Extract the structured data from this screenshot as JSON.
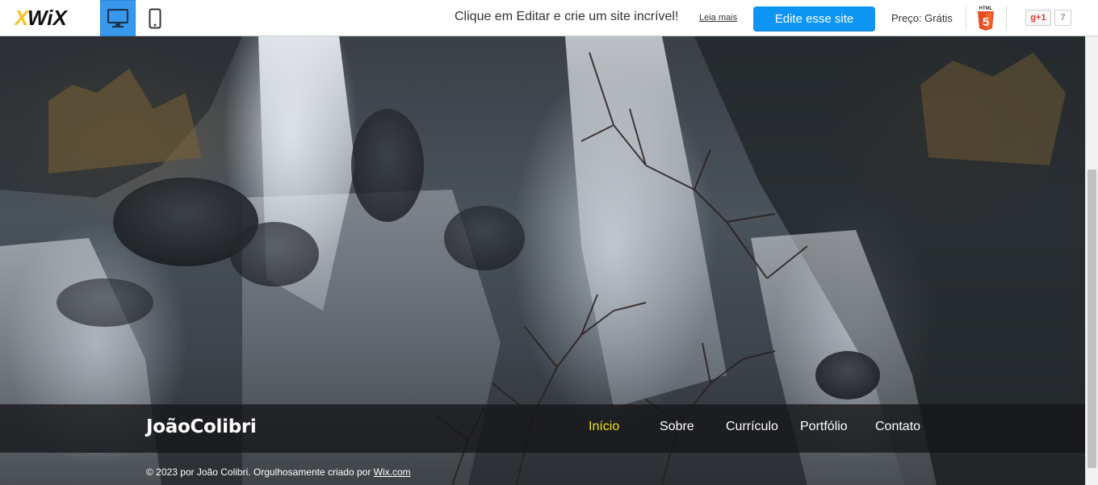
{
  "topbar": {
    "logo_text": "WIX",
    "logo_x": "X",
    "logo_rest": "WIX",
    "devices": [
      {
        "label": "desktop",
        "icon": "desktop-monitor-icon",
        "active": true
      },
      {
        "label": "mobile",
        "icon": "mobile-phone-icon",
        "active": false
      }
    ],
    "promo_text": "Clique em Editar e crie um site incrível!",
    "read_more": "Leia mais",
    "edit_button": "Edite esse site",
    "price": "Preço: Grátis",
    "html5_badge": "HTML",
    "gplus_label": "g+1",
    "gplus_count": "7",
    "colors": {
      "accent": "#0c95f3",
      "active_device": "#3899ec",
      "html5": "#e44d26"
    }
  },
  "site": {
    "title": "JoãoColibri",
    "nav": [
      {
        "label": "Início",
        "active": true
      },
      {
        "label": "Sobre",
        "active": false
      },
      {
        "label": "Currículo",
        "active": false
      },
      {
        "label": "Portfólio",
        "active": false
      },
      {
        "label": "Contato",
        "active": false
      }
    ],
    "footer_prefix": "© 2023 por João Colibri. Orgulhosamente criado por ",
    "footer_link": "Wix.com",
    "colors": {
      "nav_active": "#f4e20e",
      "nav_text": "#ffffff"
    }
  }
}
